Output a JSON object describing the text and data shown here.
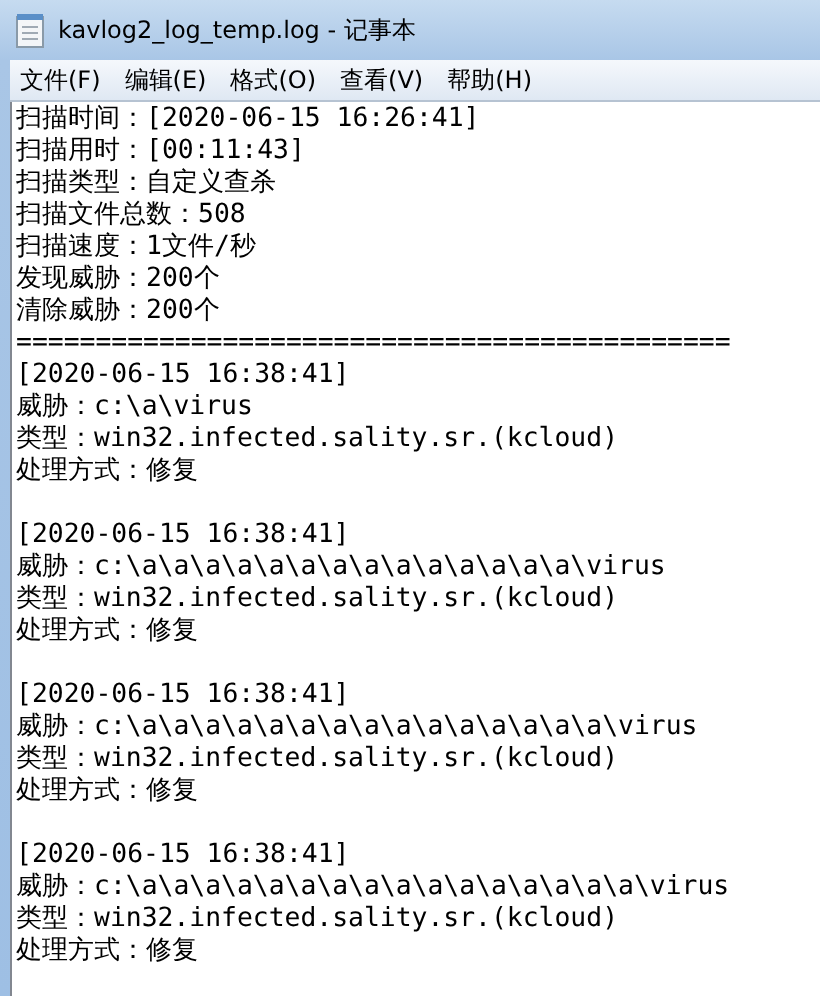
{
  "window": {
    "title": "kavlog2_log_temp.log - 记事本"
  },
  "menu": [
    {
      "label": "文件(F)"
    },
    {
      "label": "编辑(E)"
    },
    {
      "label": "格式(O)"
    },
    {
      "label": "查看(V)"
    },
    {
      "label": "帮助(H)"
    }
  ],
  "document": {
    "summary": [
      "扫描时间：[2020-06-15 16:26:41]",
      "扫描用时：[00:11:43]",
      "扫描类型：自定义查杀",
      "扫描文件总数：508",
      "扫描速度：1文件/秒",
      "发现威胁：200个",
      "清除威胁：200个"
    ],
    "separator": "=============================================",
    "records": [
      {
        "time": "[2020-06-15 16:38:41]",
        "threat": "威胁：c:\\a\\virus",
        "type": "类型：win32.infected.sality.sr.(kcloud)",
        "action": "处理方式：修复"
      },
      {
        "time": "[2020-06-15 16:38:41]",
        "threat": "威胁：c:\\a\\a\\a\\a\\a\\a\\a\\a\\a\\a\\a\\a\\a\\a\\virus",
        "type": "类型：win32.infected.sality.sr.(kcloud)",
        "action": "处理方式：修复"
      },
      {
        "time": "[2020-06-15 16:38:41]",
        "threat": "威胁：c:\\a\\a\\a\\a\\a\\a\\a\\a\\a\\a\\a\\a\\a\\a\\a\\virus",
        "type": "类型：win32.infected.sality.sr.(kcloud)",
        "action": "处理方式：修复"
      },
      {
        "time": "[2020-06-15 16:38:41]",
        "threat": "威胁：c:\\a\\a\\a\\a\\a\\a\\a\\a\\a\\a\\a\\a\\a\\a\\a\\a\\virus",
        "type": "类型：win32.infected.sality.sr.(kcloud)",
        "action": "处理方式：修复"
      }
    ]
  }
}
